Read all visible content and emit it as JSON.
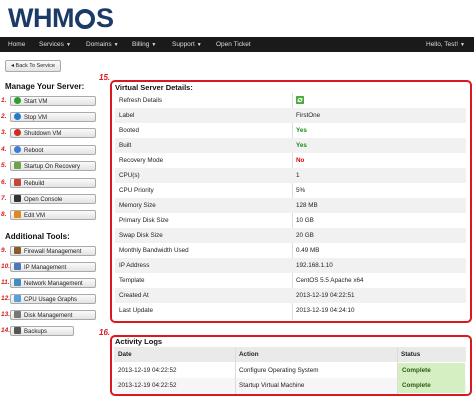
{
  "header": {
    "logo_pre": "WHM",
    "logo_post": "S"
  },
  "nav": {
    "home": "Home",
    "services": "Services",
    "domains": "Domains",
    "billing": "Billing",
    "support": "Support",
    "open_ticket": "Open Ticket",
    "user": "Hello, Test!"
  },
  "back_button": "Back To Service",
  "manage": {
    "title": "Manage Your Server:",
    "items": [
      {
        "num": "1.",
        "label": "Start VM"
      },
      {
        "num": "2.",
        "label": "Stop VM"
      },
      {
        "num": "3.",
        "label": "Shutdown VM"
      },
      {
        "num": "4.",
        "label": "Reboot"
      },
      {
        "num": "5.",
        "label": "Startup On Recovery"
      },
      {
        "num": "6.",
        "label": "Rebuild"
      },
      {
        "num": "7.",
        "label": "Open Console"
      },
      {
        "num": "8.",
        "label": "Edit VM"
      }
    ]
  },
  "tools": {
    "title": "Additional Tools:",
    "items": [
      {
        "num": "9.",
        "label": "Firewall Management"
      },
      {
        "num": "10.",
        "label": "IP Management"
      },
      {
        "num": "11.",
        "label": "Network Management"
      },
      {
        "num": "12.",
        "label": "CPU Usage Graphs"
      },
      {
        "num": "13.",
        "label": "Disk Management"
      },
      {
        "num": "14.",
        "label": "Backups"
      }
    ]
  },
  "details": {
    "num": "15.",
    "title": "Virtual Server Details:",
    "rows": [
      {
        "label": "Refresh Details",
        "value": ""
      },
      {
        "label": "Label",
        "value": "FirstOne"
      },
      {
        "label": "Booted",
        "value": "Yes"
      },
      {
        "label": "Built",
        "value": "Yes"
      },
      {
        "label": "Recovery Mode",
        "value": "No"
      },
      {
        "label": "CPU(s)",
        "value": "1"
      },
      {
        "label": "CPU Priority",
        "value": "5%"
      },
      {
        "label": "Memory Size",
        "value": "128 MB"
      },
      {
        "label": "Primary Disk Size",
        "value": "10 GB"
      },
      {
        "label": "Swap Disk Size",
        "value": "20 GB"
      },
      {
        "label": "Monthly Bandwidth Used",
        "value": "0.49 MB"
      },
      {
        "label": "IP Address",
        "value": "192.168.1.10"
      },
      {
        "label": "Template",
        "value": "CentOS 5.5 Apache x64"
      },
      {
        "label": "Created At",
        "value": "2013-12-19 04:22:51"
      },
      {
        "label": "Last Update",
        "value": "2013-12-19 04:24:10"
      }
    ]
  },
  "logs": {
    "num": "16.",
    "title": "Activity Logs",
    "headers": {
      "date": "Date",
      "action": "Action",
      "status": "Status"
    },
    "rows": [
      {
        "date": "2013-12-19 04:22:52",
        "action": "Configure Operating System",
        "status": "Complete"
      },
      {
        "date": "2013-12-19 04:22:52",
        "action": "Startup Virtual Machine",
        "status": "Complete"
      }
    ]
  },
  "colors": {
    "annotation_red": "#d9191f",
    "nav_bg": "#1a1a1a",
    "logo_blue": "#1b3a66",
    "yes_green": "#198c19",
    "no_red": "#dd0000",
    "complete_bg": "#d6efc2"
  }
}
